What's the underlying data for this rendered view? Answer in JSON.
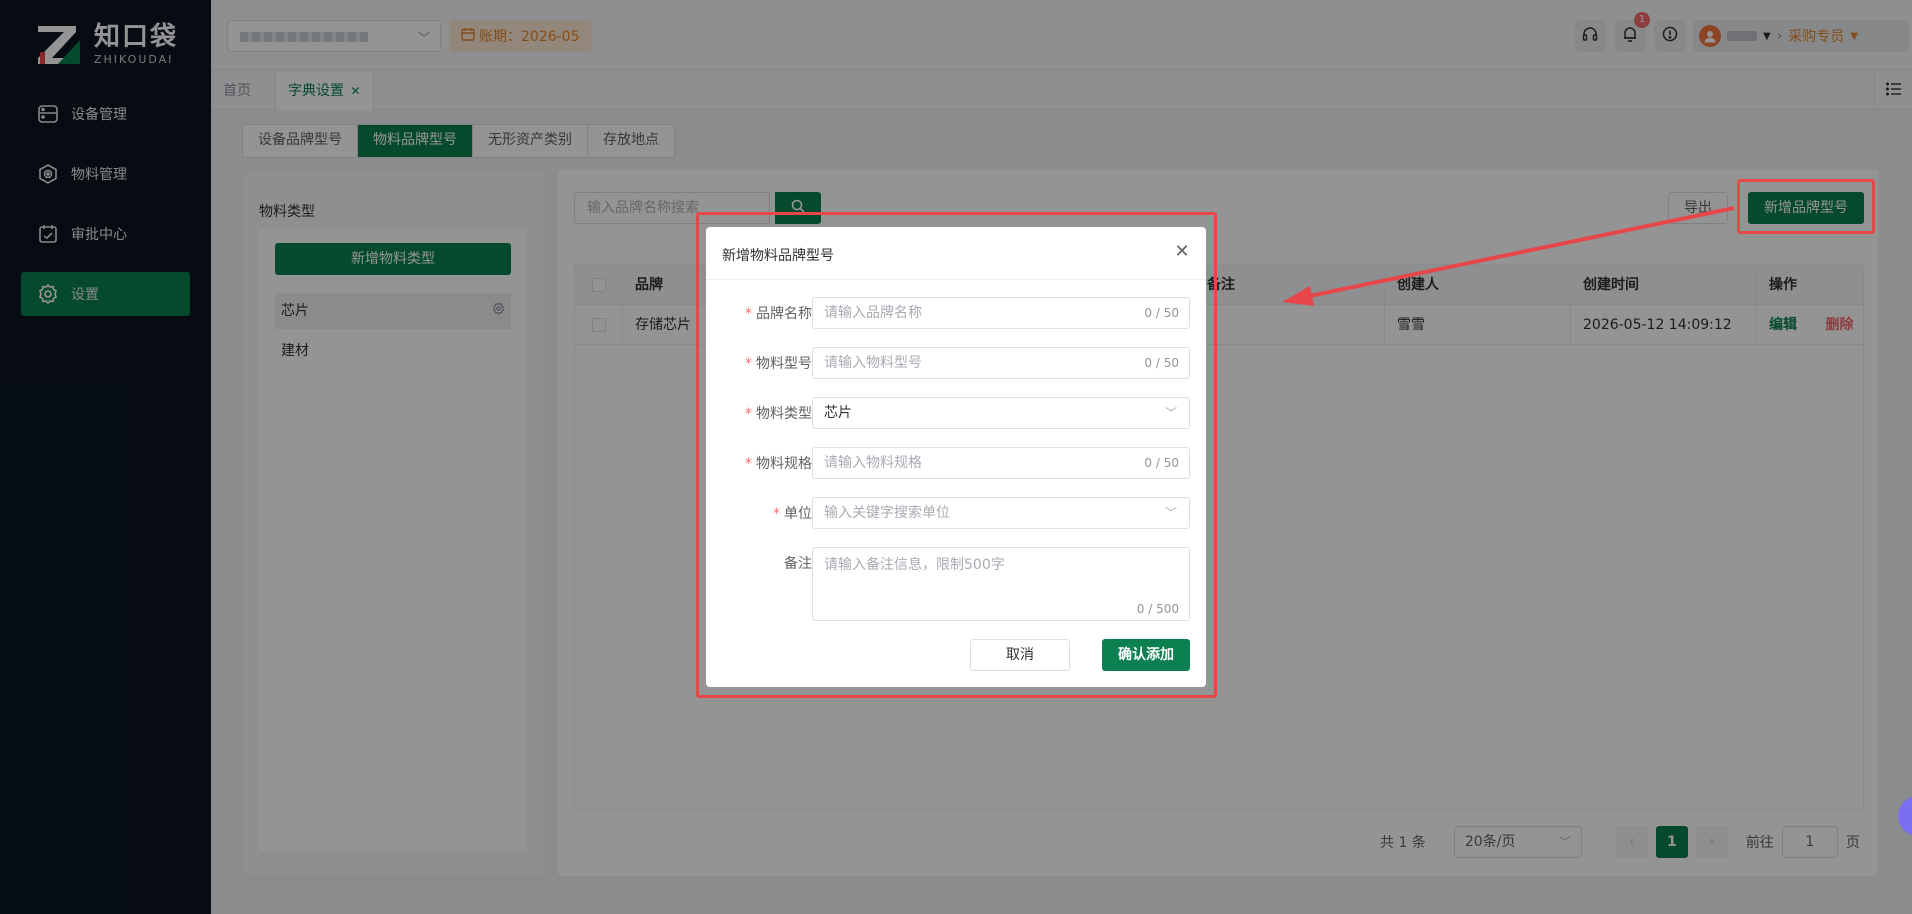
{
  "app": {
    "logo_cn": "知口袋",
    "logo_en": "ZHIKOUDAI"
  },
  "colors": {
    "brand": "#0c8050",
    "sidebar_bg": "#0b1520",
    "accent_orange": "#e6862a",
    "danger": "#f56c6c",
    "highlight": "#e8474a"
  },
  "sidebar": {
    "items": [
      {
        "label": "设备管理",
        "icon": "device-icon"
      },
      {
        "label": "物料管理",
        "icon": "material-icon"
      },
      {
        "label": "审批中心",
        "icon": "approval-icon"
      },
      {
        "label": "设置",
        "icon": "gear-icon",
        "active": true
      }
    ]
  },
  "header": {
    "period": "账期：2026-05",
    "notification_count": "1",
    "role": "采购专员"
  },
  "page_tabs": [
    {
      "label": "首页"
    },
    {
      "label": "字典设置",
      "active": true
    }
  ],
  "sub_tabs": [
    {
      "label": "设备品牌型号"
    },
    {
      "label": "物料品牌型号",
      "active": true
    },
    {
      "label": "无形资产类别"
    },
    {
      "label": "存放地点"
    }
  ],
  "left_panel": {
    "title": "物料类型",
    "add_button": "新增物料类型",
    "types": [
      "芯片",
      "建材"
    ]
  },
  "right_panel": {
    "search_placeholder": "输入品牌名称搜索",
    "export_label": "导出",
    "add_label": "新增品牌型号",
    "table": {
      "headers": [
        "品牌",
        "备注",
        "创建人",
        "创建时间",
        "操作"
      ],
      "rows": [
        {
          "brand": "存储芯片",
          "creator": "雪雪",
          "created_at": "2026-05-12 14:09:12",
          "edit": "编辑",
          "delete": "删除"
        }
      ]
    },
    "pager": {
      "total": "共 1 条",
      "page_size": "20条/页",
      "current": "1",
      "goto_label": "前往",
      "goto_value": "1",
      "page_suffix": "页"
    }
  },
  "dialog": {
    "title": "新增物料品牌型号",
    "fields": [
      {
        "label": "品牌名称",
        "required": true,
        "placeholder": "请输入品牌名称",
        "count": "0 / 50"
      },
      {
        "label": "物料型号",
        "required": true,
        "placeholder": "请输入物料型号",
        "count": "0 / 50"
      },
      {
        "label": "物料类型",
        "required": true,
        "value": "芯片"
      },
      {
        "label": "物料规格",
        "required": true,
        "placeholder": "请输入物料规格",
        "count": "0 / 50"
      },
      {
        "label": "单位",
        "required": true,
        "placeholder": "输入关键字搜索单位"
      },
      {
        "label": "备注",
        "required": false,
        "placeholder": "请输入备注信息，限制500字",
        "count": "0 / 500"
      }
    ],
    "cancel_label": "取消",
    "confirm_label": "确认添加"
  }
}
